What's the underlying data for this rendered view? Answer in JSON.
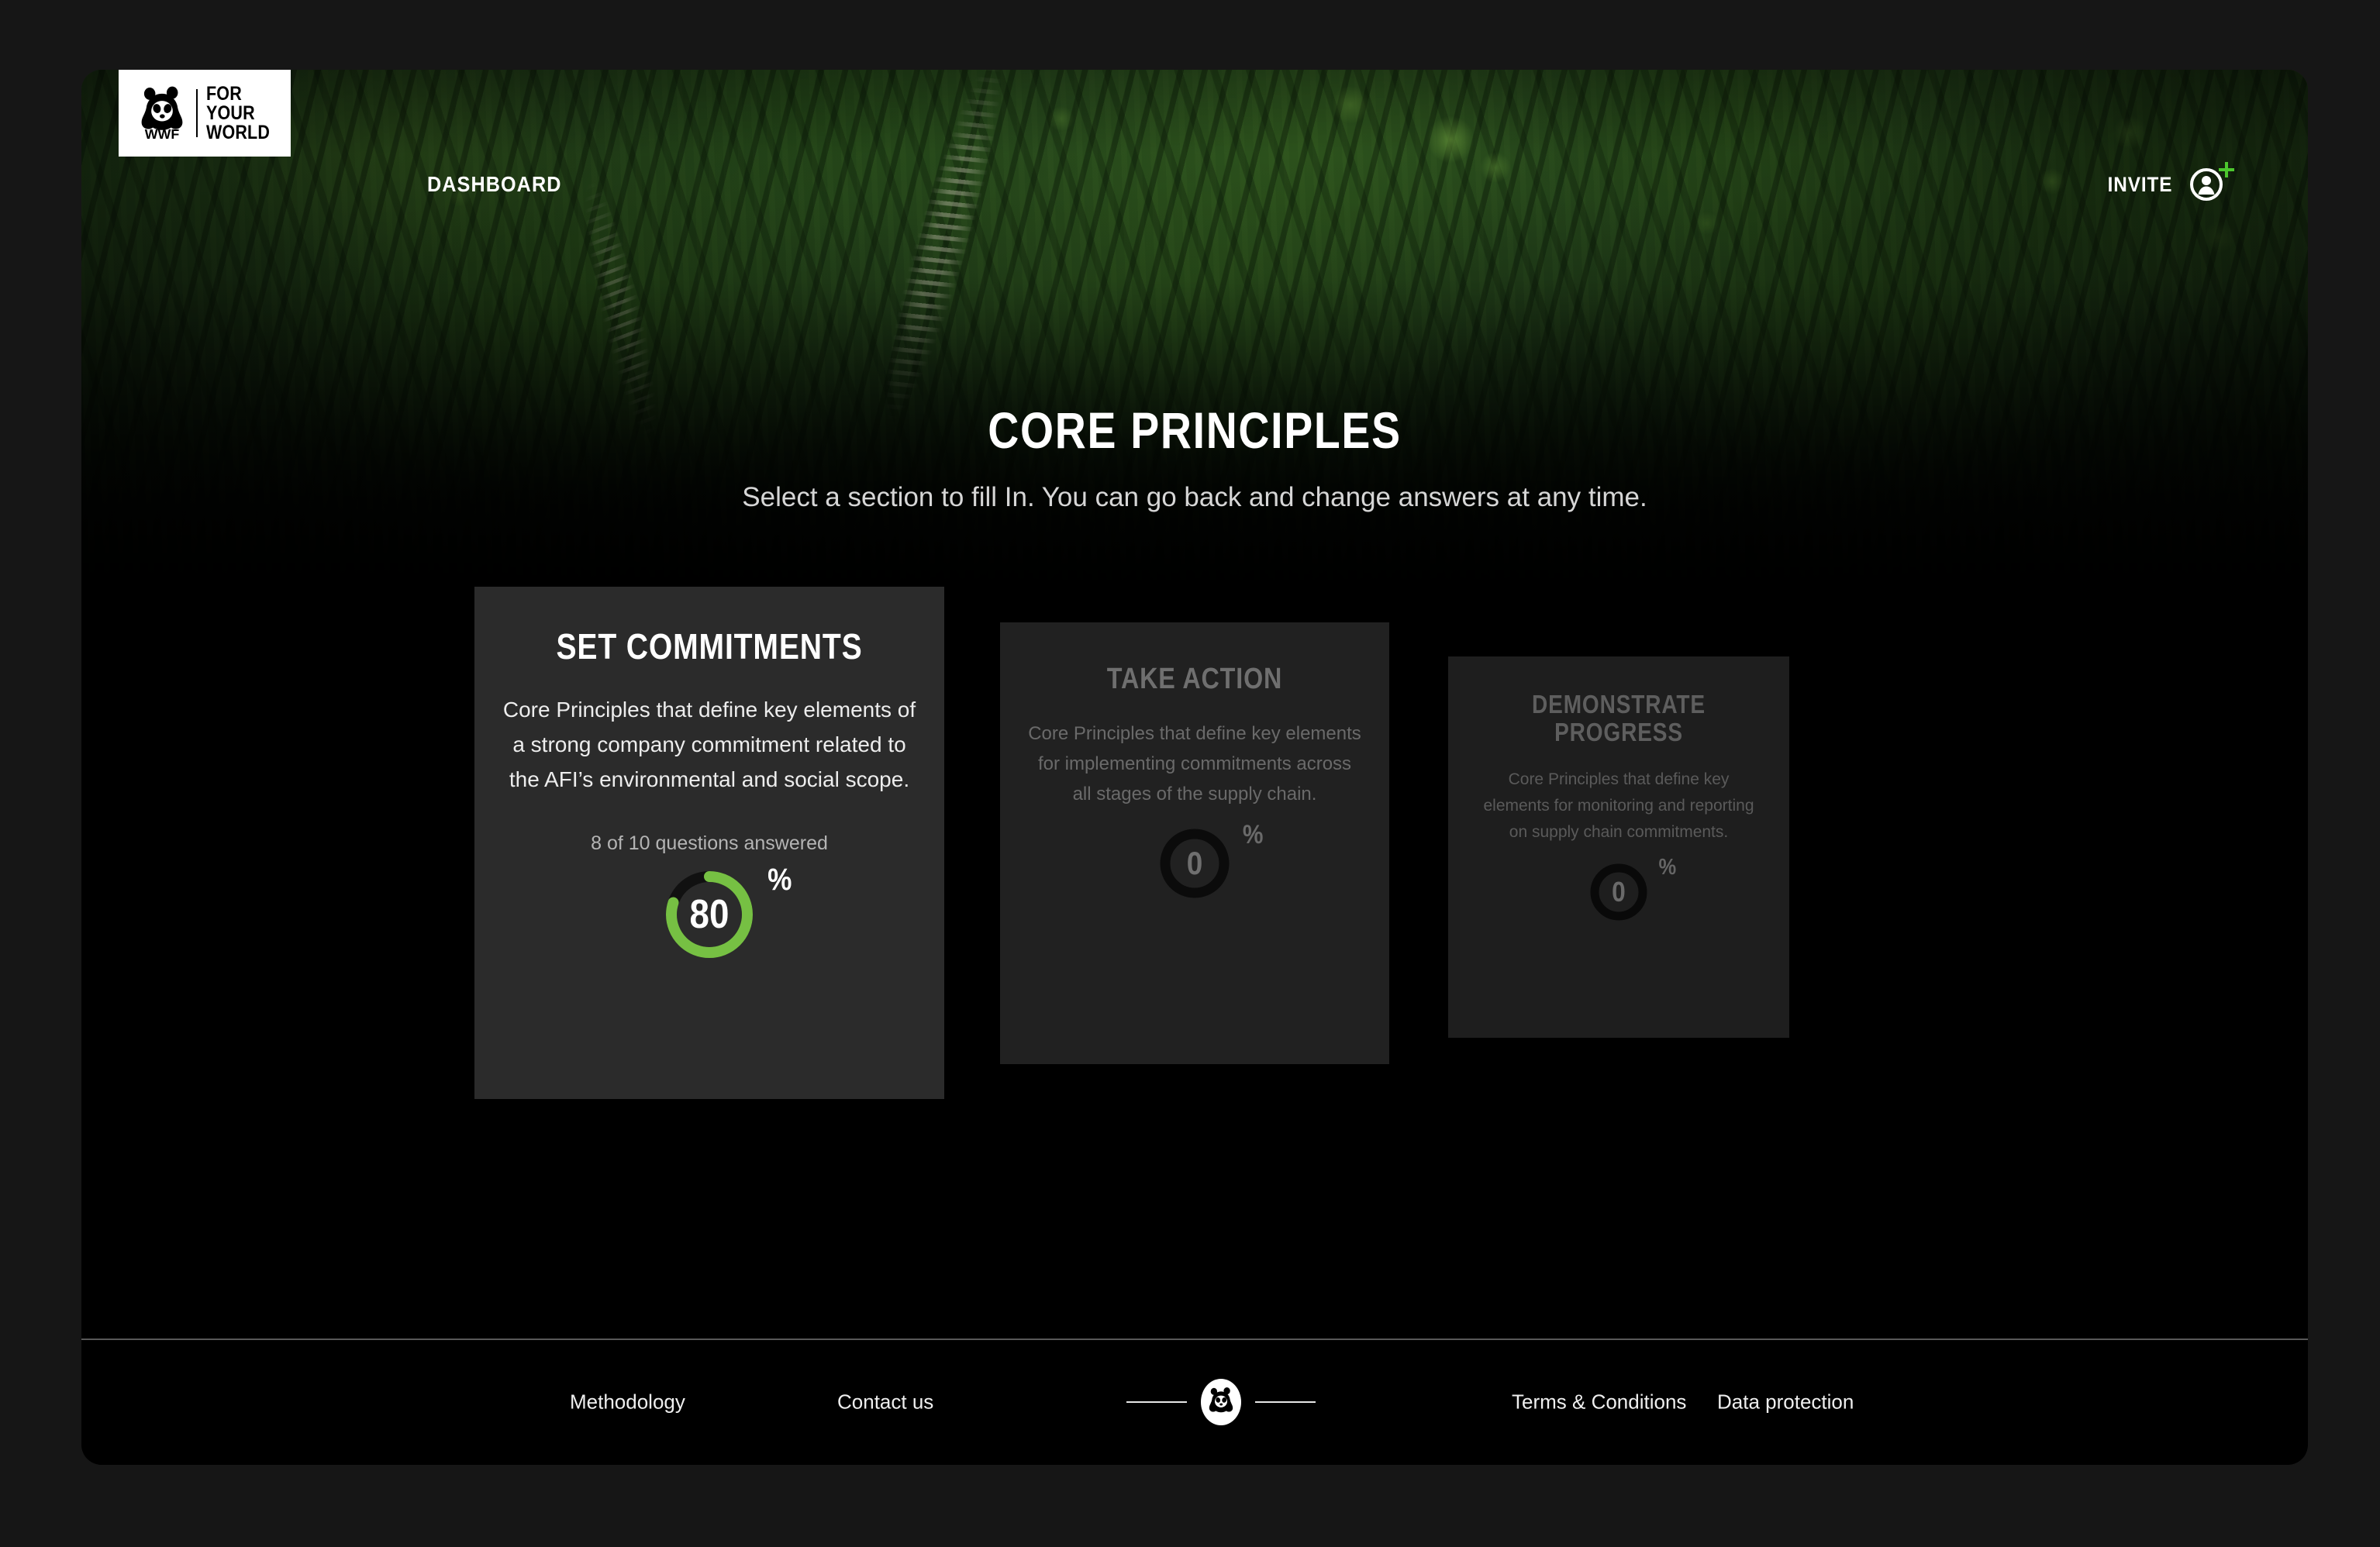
{
  "header": {
    "logo": {
      "icon": "wwf-panda-logo",
      "wordmark": "WWF",
      "tagline_line1": "FOR",
      "tagline_line2": "YOUR",
      "tagline_line3": "WORLD"
    },
    "nav": {
      "dashboard_label": "DASHBOARD"
    },
    "invite": {
      "label": "INVITE",
      "user_icon": "user-circle-icon",
      "plus_icon": "plus-icon",
      "plus_color": "#4CC72E"
    }
  },
  "hero": {
    "title": "CORE PRINCIPLES",
    "subtitle": "Select a section to fill In. You can go back and change answers at any time."
  },
  "cards": [
    {
      "id": "set-commitments",
      "title": "SET COMMITMENTS",
      "description": "Core Principles that define key elements of a strong company commitment related to the AFI’s environmental and social scope.",
      "answered_text": "8 of 10 questions answered",
      "questions_answered": 8,
      "questions_total": 10,
      "percent": 80,
      "percent_label": "80",
      "percent_symbol": "%",
      "state": "active",
      "ring_color": "#76C043",
      "ring_track_color": "#111111"
    },
    {
      "id": "take-action",
      "title": "TAKE ACTION",
      "description": "Core Principles that define key elements for implementing commitments across all stages of the supply chain.",
      "answered_text": "",
      "percent": 0,
      "percent_label": "0",
      "percent_symbol": "%",
      "state": "inactive",
      "ring_color": "#0b0b0b",
      "ring_track_color": "#0b0b0b"
    },
    {
      "id": "demonstrate-progress",
      "title": "DEMONSTRATE PROGRESS",
      "description": "Core Principles that define key elements for monitoring and reporting on supply chain commitments.",
      "answered_text": "",
      "percent": 0,
      "percent_label": "0",
      "percent_symbol": "%",
      "state": "inactive",
      "ring_color": "#090909",
      "ring_track_color": "#090909"
    }
  ],
  "footer": {
    "links": [
      {
        "label": "Methodology"
      },
      {
        "label": "Contact us"
      },
      {
        "label": "Terms & Conditions"
      },
      {
        "label": "Data protection"
      }
    ],
    "badge_icon": "wwf-panda-badge-icon"
  },
  "theme": {
    "accent_green": "#76C043",
    "invite_plus_green": "#4CC72E",
    "page_background": "#161616",
    "container_background": "#000000",
    "card_active_background": "#2b2b2b"
  }
}
